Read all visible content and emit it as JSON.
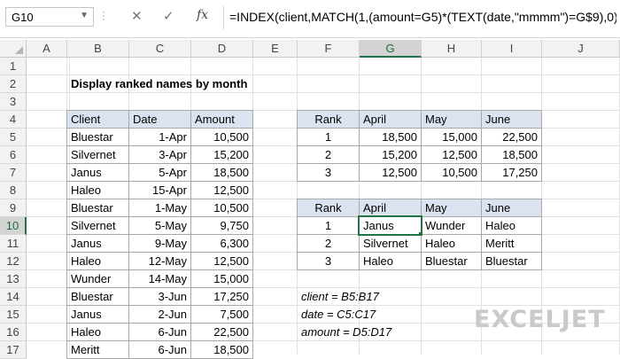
{
  "formula_bar": {
    "name_box": "G10",
    "fx_label": "fx",
    "cancel_glyph": "✕",
    "enter_glyph": "✓",
    "formula": "=INDEX(client,MATCH(1,(amount=G5)*(TEXT(date,\"mmmm\")=G$9),0))"
  },
  "columns": [
    "A",
    "B",
    "C",
    "D",
    "E",
    "F",
    "G",
    "H",
    "I",
    "J"
  ],
  "rows": [
    "1",
    "2",
    "3",
    "4",
    "5",
    "6",
    "7",
    "8",
    "9",
    "10",
    "11",
    "12",
    "13",
    "14",
    "15",
    "16",
    "17"
  ],
  "selected": {
    "column": "G",
    "row": "10"
  },
  "title": "Display ranked names by month",
  "data_table": {
    "headers": [
      "Client",
      "Date",
      "Amount"
    ],
    "rows": [
      [
        "Bluestar",
        "1-Apr",
        "10,500"
      ],
      [
        "Silvernet",
        "3-Apr",
        "15,200"
      ],
      [
        "Janus",
        "5-Apr",
        "18,500"
      ],
      [
        "Haleo",
        "15-Apr",
        "12,500"
      ],
      [
        "Bluestar",
        "1-May",
        "10,500"
      ],
      [
        "Silvernet",
        "5-May",
        "9,750"
      ],
      [
        "Janus",
        "9-May",
        "6,300"
      ],
      [
        "Haleo",
        "12-May",
        "12,500"
      ],
      [
        "Wunder",
        "14-May",
        "15,000"
      ],
      [
        "Bluestar",
        "3-Jun",
        "17,250"
      ],
      [
        "Janus",
        "2-Jun",
        "7,500"
      ],
      [
        "Haleo",
        "6-Jun",
        "22,500"
      ],
      [
        "Meritt",
        "6-Jun",
        "18,500"
      ]
    ]
  },
  "amount_table": {
    "headers": [
      "Rank",
      "April",
      "May",
      "June"
    ],
    "rows": [
      [
        "1",
        "18,500",
        "15,000",
        "22,500"
      ],
      [
        "2",
        "15,200",
        "12,500",
        "18,500"
      ],
      [
        "3",
        "12,500",
        "10,500",
        "17,250"
      ]
    ]
  },
  "name_table": {
    "headers": [
      "Rank",
      "April",
      "May",
      "June"
    ],
    "rows": [
      [
        "1",
        "Janus",
        "Wunder",
        "Haleo"
      ],
      [
        "2",
        "Silvernet",
        "Haleo",
        "Meritt"
      ],
      [
        "3",
        "Haleo",
        "Bluestar",
        "Bluestar"
      ]
    ]
  },
  "notes": [
    "client = B5:B17",
    "date = C5:C17",
    "amount = D5:D17"
  ],
  "watermark": "EXCELJET",
  "colors": {
    "accent": "#217346",
    "header_fill": "#dce3f0",
    "gridline": "#e1e1e1"
  }
}
